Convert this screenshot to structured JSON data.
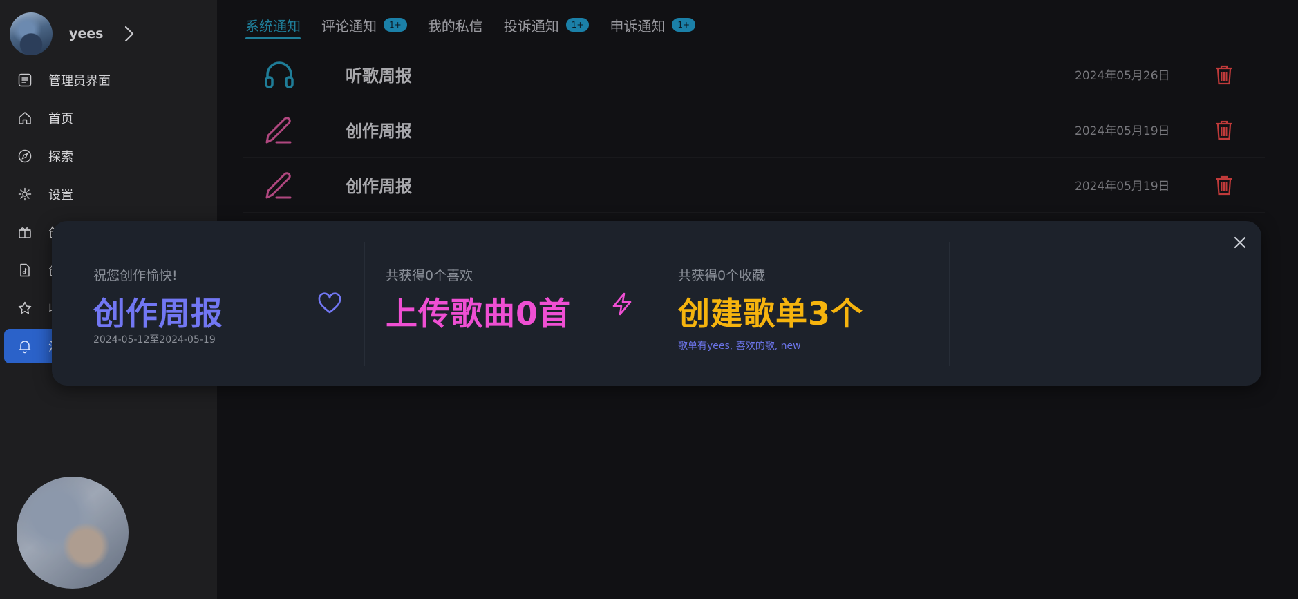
{
  "user": {
    "name": "yees"
  },
  "sidebar": {
    "items": [
      {
        "label": "管理员界面",
        "icon": "list-icon"
      },
      {
        "label": "首页",
        "icon": "home-icon"
      },
      {
        "label": "探索",
        "icon": "compass-icon"
      },
      {
        "label": "设置",
        "icon": "gear-icon"
      },
      {
        "label": "创",
        "icon": "gift-icon"
      },
      {
        "label": "创",
        "icon": "music-file-icon"
      },
      {
        "label": "收",
        "icon": "star-icon"
      },
      {
        "label": "消",
        "icon": "bell-icon",
        "active": true
      }
    ]
  },
  "tabs": [
    {
      "label": "系统通知",
      "active": true
    },
    {
      "label": "评论通知",
      "badge": "1+"
    },
    {
      "label": "我的私信"
    },
    {
      "label": "投诉通知",
      "badge": "1+"
    },
    {
      "label": "申诉通知",
      "badge": "1+"
    }
  ],
  "notifications": [
    {
      "title": "听歌周报",
      "date": "2024年05月26日",
      "icon": "headphones-icon"
    },
    {
      "title": "创作周报",
      "date": "2024年05月19日",
      "icon": "pen-icon"
    },
    {
      "title": "创作周报",
      "date": "2024年05月19日",
      "icon": "pen-icon"
    }
  ],
  "dialog": {
    "card1": {
      "sub": "祝您创作愉快!",
      "big": "创作周报",
      "note": "2024-05-12至2024-05-19"
    },
    "card2": {
      "sub": "共获得0个喜欢",
      "big": "上传歌曲0首"
    },
    "card3": {
      "sub": "共获得0个收藏",
      "big": "创建歌单3个",
      "note": "歌单有yees, 喜欢的歌, new"
    }
  },
  "colors": {
    "accent": "#1f7d98",
    "active_nav": "#2b62c9",
    "card1_big": "#7277f3",
    "card2_big": "#ef4fd3",
    "card3_big": "#f6b40e",
    "delete": "#c03a3a",
    "pen": "#b0477f"
  }
}
